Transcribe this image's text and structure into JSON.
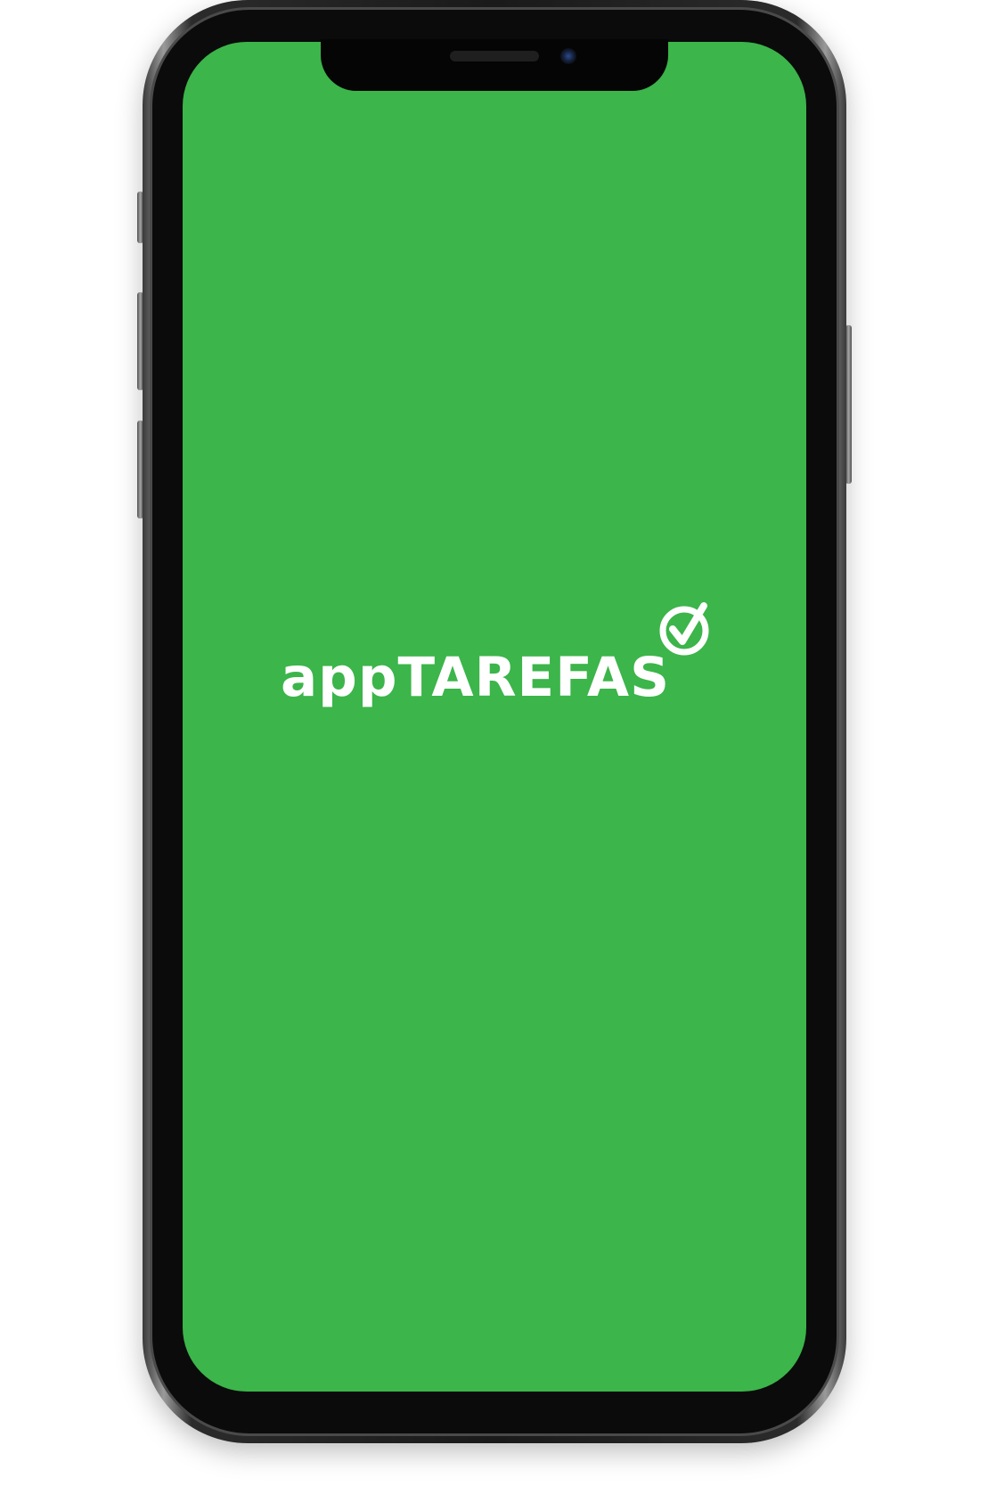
{
  "app": {
    "logo_text": "appTAREFAS",
    "logo_icon": "check-circle-icon"
  },
  "colors": {
    "screen_background": "#3CB54A",
    "logo_foreground": "#FFFFFF",
    "device_frame": "#1A1A1A"
  }
}
